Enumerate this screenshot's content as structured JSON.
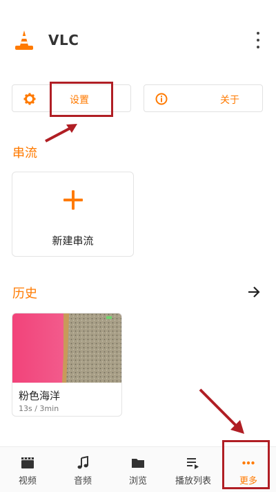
{
  "app": {
    "title": "VLC"
  },
  "actions": {
    "settings_label": "设置",
    "about_label": "关于"
  },
  "stream": {
    "section_title": "串流",
    "new_stream_label": "新建串流"
  },
  "history": {
    "section_title": "历史",
    "items": [
      {
        "title": "粉色海洋",
        "meta": "13s / 3min"
      }
    ]
  },
  "bottom_nav": {
    "items": [
      {
        "label": "视频",
        "icon": "video-icon"
      },
      {
        "label": "音频",
        "icon": "music-note-icon"
      },
      {
        "label": "浏览",
        "icon": "folder-icon"
      },
      {
        "label": "播放列表",
        "icon": "playlist-icon"
      },
      {
        "label": "更多",
        "icon": "more-dots-icon"
      }
    ],
    "active_index": 4
  },
  "colors": {
    "accent": "#ff7a00",
    "annotation": "#b01e24"
  }
}
